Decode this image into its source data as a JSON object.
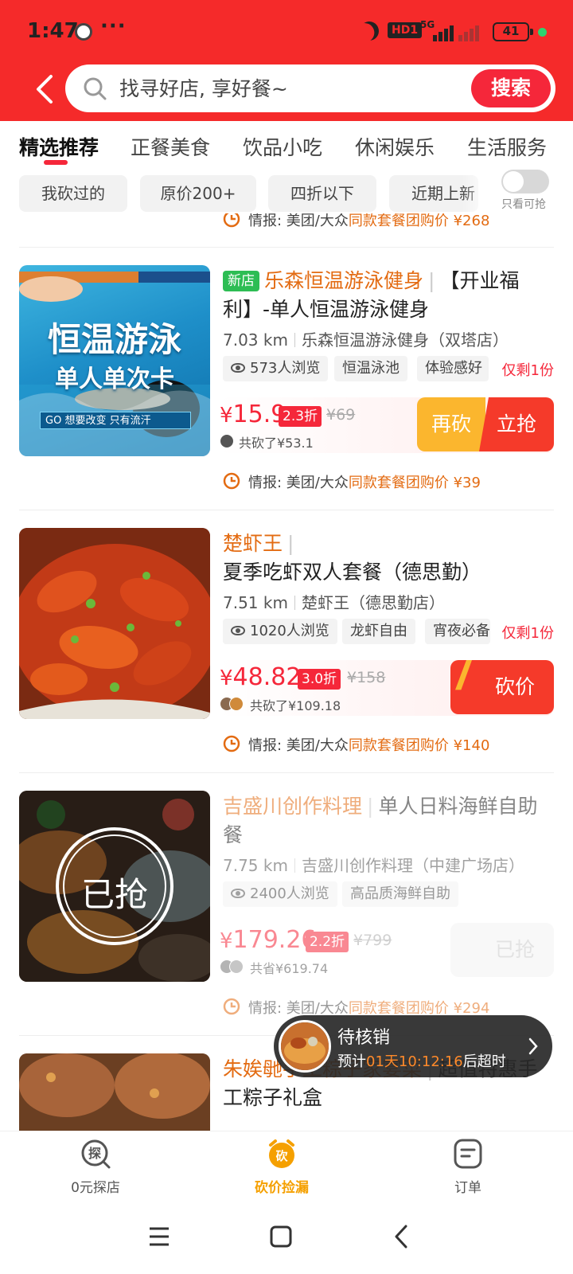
{
  "status_bar": {
    "time": "1:47",
    "dots": "···",
    "hd": "HD1",
    "network": "5G",
    "battery": "41"
  },
  "search": {
    "placeholder": "找寻好店, 享好餐~",
    "button": "搜索"
  },
  "tabs": [
    {
      "label": "精选推荐",
      "active": true
    },
    {
      "label": "正餐美食",
      "active": false
    },
    {
      "label": "饮品小吃",
      "active": false
    },
    {
      "label": "休闲娱乐",
      "active": false
    },
    {
      "label": "生活服务",
      "active": false
    }
  ],
  "filters": [
    "我砍过的",
    "原价200+",
    "四折以下",
    "近期上新"
  ],
  "toggle": {
    "label": "只看可抢",
    "on": false
  },
  "top_intel": {
    "prefix": "情报: 美团/大众",
    "link": "同款套餐团购价",
    "price": "¥268"
  },
  "deals": [
    {
      "new_badge": "新店",
      "shop": "乐森恒温游泳健身",
      "title": "【开业福利】-单人恒温游泳健身",
      "distance": "7.03 km",
      "store": "乐森恒温游泳健身（双塔店）",
      "views": "573人浏览",
      "tags": [
        "恒温泳池",
        "体验感好"
      ],
      "remaining": "仅剩1份",
      "price_symbol": "¥",
      "price": "15.9",
      "discount": "2.3折",
      "original": "¥69",
      "saved": "共砍了¥53.1",
      "buttons": [
        "再砍",
        "立抢"
      ],
      "image_text": {
        "line1": "恒温游泳",
        "line2": "单人单次卡",
        "banner": "GO 想要改变 只有流汗"
      },
      "intel": {
        "prefix": "情报: 美团/大众",
        "link": "同款套餐团购价",
        "price": "¥39"
      }
    },
    {
      "shop": "楚虾王",
      "title": "夏季吃虾双人套餐（德思勤）",
      "distance": "7.51 km",
      "store": "楚虾王（德思勤店）",
      "views": "1020人浏览",
      "tags": [
        "龙虾自由",
        "宵夜必备"
      ],
      "remaining": "仅剩1份",
      "price_symbol": "¥",
      "price": "48.82",
      "discount": "3.0折",
      "original": "¥158",
      "saved": "共砍了¥109.18",
      "buttons": [
        "砍价"
      ],
      "intel": {
        "prefix": "情报: 美团/大众",
        "link": "同款套餐团购价",
        "price": "¥140"
      }
    },
    {
      "shop": "吉盛川创作料理",
      "title": "单人日料海鲜自助餐",
      "distance": "7.75 km",
      "store": "吉盛川创作料理（中建广场店）",
      "views": "2400人浏览",
      "tags": [
        "高品质海鲜自助"
      ],
      "sold_stamp": "已抢",
      "price_symbol": "¥",
      "price": "179.26",
      "discount": "2.2折",
      "original": "¥799",
      "saved": "共省¥619.74",
      "buttons": [
        "已抢"
      ],
      "intel": {
        "prefix": "情报: 美团/大众",
        "link": "同款套餐团购价",
        "price": "¥294"
      }
    },
    {
      "shop": "朱娭毑手工粽子家宴菜",
      "title": "超值特惠手工粽子礼盒"
    }
  ],
  "pending": {
    "title": "待核销",
    "prefix": "预计",
    "countdown": "01天10:12:16",
    "suffix": "后超时"
  },
  "bottom_nav": [
    {
      "label": "0元探店",
      "icon_char": "探",
      "active": false
    },
    {
      "label": "砍价捡漏",
      "icon_char": "砍",
      "active": true
    },
    {
      "label": "订单",
      "active": false
    }
  ],
  "colors": {
    "header_red": "#f52a2a",
    "accent_red": "#f5273a",
    "shop_orange": "#e36b12",
    "new_green": "#2dbd54",
    "again_yellow": "#fbb62e"
  }
}
